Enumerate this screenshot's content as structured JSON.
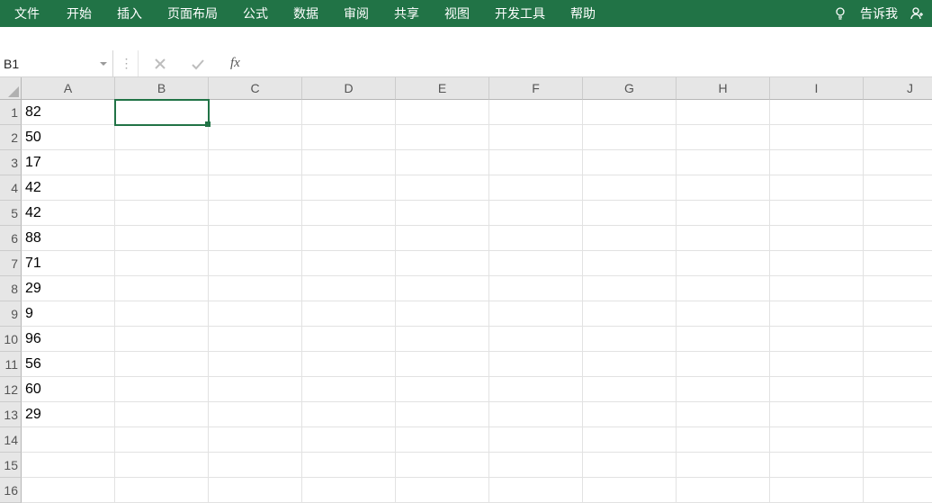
{
  "ribbon": {
    "tabs": [
      "文件",
      "开始",
      "插入",
      "页面布局",
      "公式",
      "数据",
      "审阅",
      "共享",
      "视图",
      "开发工具",
      "帮助"
    ],
    "tell_me": "告诉我"
  },
  "formula_bar": {
    "name_box": "B1",
    "fx_label": "fx",
    "formula_value": ""
  },
  "grid": {
    "columns": [
      "A",
      "B",
      "C",
      "D",
      "E",
      "F",
      "G",
      "H",
      "I",
      "J"
    ],
    "row_count": 16,
    "col_a_values": [
      "82",
      "50",
      "17",
      "42",
      "42",
      "88",
      "71",
      "29",
      "9",
      "96",
      "56",
      "60",
      "29",
      "",
      "",
      ""
    ],
    "active_cell": {
      "col_index": 1,
      "row_index": 0
    }
  }
}
